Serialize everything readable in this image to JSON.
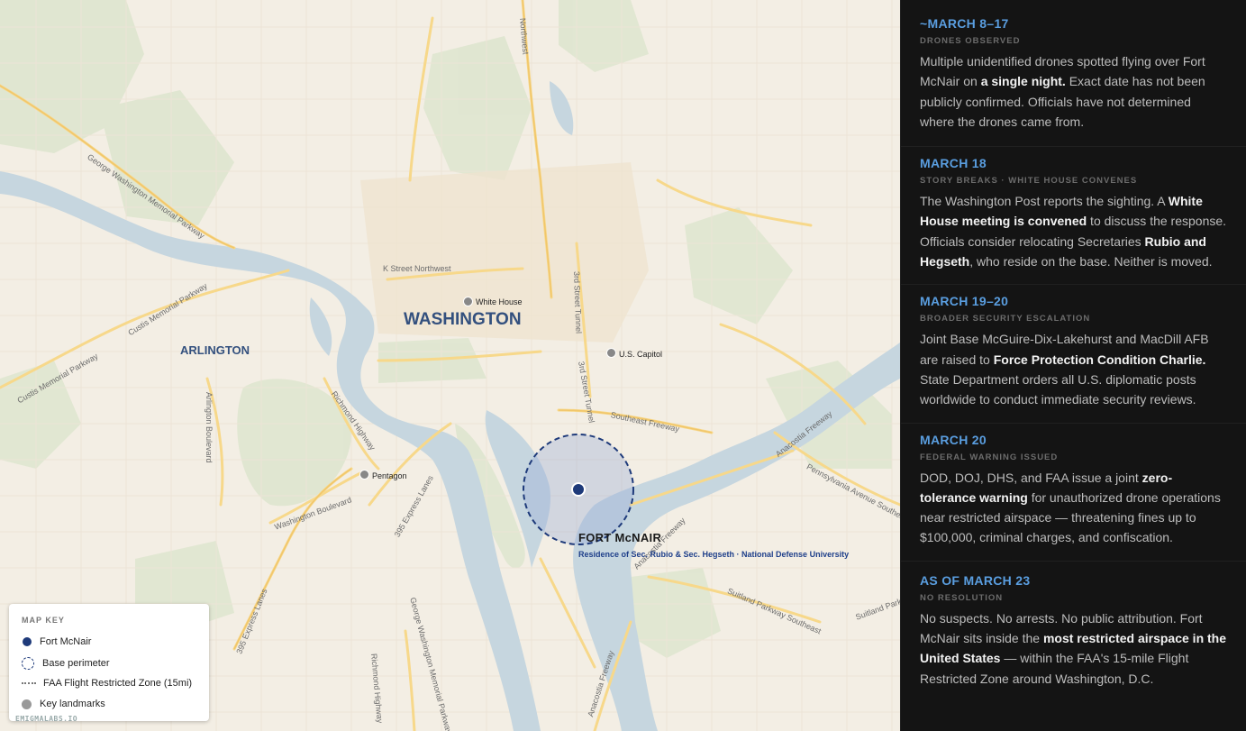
{
  "map": {
    "cities": {
      "washington": "WASHINGTON",
      "arlington": "ARLINGTON"
    },
    "roads": {
      "k_street": "K Street Northwest",
      "gw_parkway": "George Washington Memorial Parkway",
      "gw_parkway_south": "George Washington Memorial Parkway",
      "custis": "Custis Memorial Parkway",
      "custis2": "Custis Memorial Parkway",
      "arlington_blvd": "Arlington Boulevard",
      "richmond_hwy": "Richmond Highway",
      "richmond_hwy_south": "Richmond Highway",
      "i395_a": "395 Express Lanes",
      "i395_b": "395 Express Lanes",
      "washington_blvd": "Washington Boulevard",
      "third_street": "3rd Street Tunnel",
      "third_street2": "3rd Street Tunnel",
      "se_freeway": "Southeast Freeway",
      "anacostia_fwy": "Anacostia Freeway",
      "anacostia_fwy2": "Anacostia Freeway",
      "anacostia_fwy3": "Anacostia Freeway",
      "penn_ave": "Pennsylvania Avenue Southeast",
      "suitland": "Suitland Parkway Southeast",
      "suitland2": "Suitland Parkway",
      "northwest": "Northwest"
    },
    "landmarks": {
      "white_house": "White House",
      "capitol": "U.S. Capitol",
      "pentagon": "Pentagon"
    },
    "mcnair": {
      "title": "FORT McNAIR",
      "subtitle": "Residence of Sec. Rubio & Sec. Hegseth · National Defense University"
    }
  },
  "key": {
    "title": "MAP KEY",
    "items": [
      {
        "label": "Fort McNair",
        "icon": "navy-dot-icon"
      },
      {
        "label": "Base perimeter",
        "icon": "dashed-circle-icon"
      },
      {
        "label": "FAA Flight Restricted Zone (15mi)",
        "icon": "dotted-line-icon"
      },
      {
        "label": "Key landmarks",
        "icon": "gray-dot-icon"
      }
    ]
  },
  "watermark": "EMIGMALABS.IO",
  "colors": {
    "accent": "#5a9ee0",
    "navy": "#1e3a7a",
    "water": "#c6d6df",
    "panel": "#141414"
  },
  "timeline": [
    {
      "date": "~MARCH 8–17",
      "subtitle": "DRONES OBSERVED",
      "body": [
        {
          "t": "Multiple unidentified drones spotted flying over Fort McNair on "
        },
        {
          "t": "a single night.",
          "b": true
        },
        {
          "t": " Exact date has not been publicly confirmed. Officials have not determined where the drones came from."
        }
      ]
    },
    {
      "date": "MARCH 18",
      "subtitle": "STORY BREAKS · WHITE HOUSE CONVENES",
      "body": [
        {
          "t": "The Washington Post reports the sighting. A "
        },
        {
          "t": "White House meeting is convened",
          "b": true
        },
        {
          "t": " to discuss the response. Officials consider relocating Secretaries "
        },
        {
          "t": "Rubio and Hegseth",
          "b": true
        },
        {
          "t": ", who reside on the base. Neither is moved."
        }
      ]
    },
    {
      "date": "MARCH 19–20",
      "subtitle": "BROADER SECURITY ESCALATION",
      "body": [
        {
          "t": "Joint Base McGuire-Dix-Lakehurst and MacDill AFB are raised to "
        },
        {
          "t": "Force Protection Condition Charlie.",
          "b": true
        },
        {
          "t": " State Department orders all U.S. diplomatic posts worldwide to conduct immediate security reviews."
        }
      ]
    },
    {
      "date": "MARCH 20",
      "subtitle": "FEDERAL WARNING ISSUED",
      "body": [
        {
          "t": "DOD, DOJ, DHS, and FAA issue a joint "
        },
        {
          "t": "zero-tolerance warning",
          "b": true
        },
        {
          "t": " for unauthorized drone operations near restricted airspace — threatening fines up to $100,000, criminal charges, and confiscation."
        }
      ]
    },
    {
      "date": "AS OF MARCH 23",
      "subtitle": "NO RESOLUTION",
      "body": [
        {
          "t": "No suspects. No arrests. No public attribution. Fort McNair sits inside the "
        },
        {
          "t": "most restricted airspace in the United States",
          "b": true
        },
        {
          "t": " — within the FAA's 15-mile Flight Restricted Zone around Washington, D.C."
        }
      ]
    }
  ]
}
